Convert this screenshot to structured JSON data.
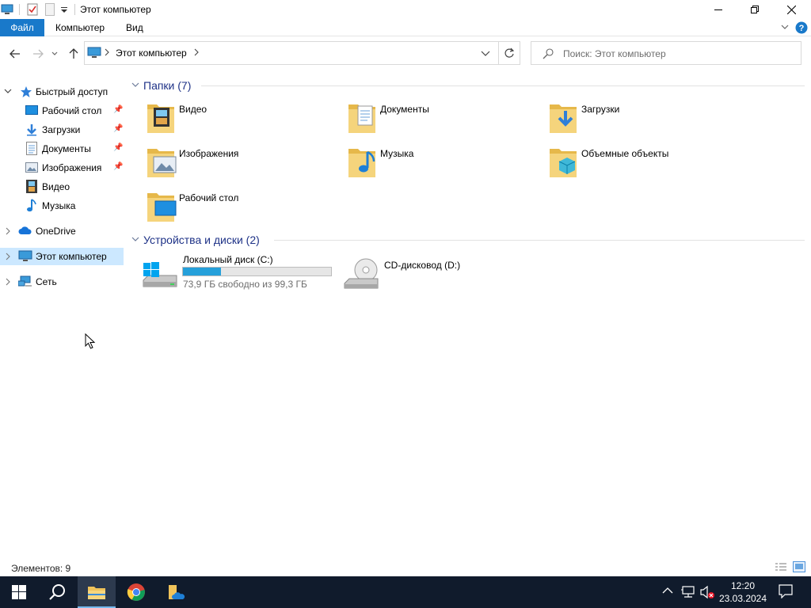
{
  "window": {
    "title": "Этот компьютер"
  },
  "ribbon": {
    "tabs": [
      "Файл",
      "Компьютер",
      "Вид"
    ]
  },
  "address": {
    "path_root": "Этот компьютер",
    "search_placeholder": "Поиск: Этот компьютер"
  },
  "nav": {
    "quick_access": "Быстрый доступ",
    "items": [
      "Рабочий стол",
      "Загрузки",
      "Документы",
      "Изображения",
      "Видео",
      "Музыка"
    ],
    "onedrive": "OneDrive",
    "this_pc": "Этот компьютер",
    "network": "Сеть"
  },
  "folders": {
    "header": "Папки (7)",
    "items": [
      {
        "label": "Видео",
        "icon": "video-folder-icon"
      },
      {
        "label": "Документы",
        "icon": "documents-folder-icon"
      },
      {
        "label": "Загрузки",
        "icon": "downloads-folder-icon"
      },
      {
        "label": "Изображения",
        "icon": "pictures-folder-icon"
      },
      {
        "label": "Музыка",
        "icon": "music-folder-icon"
      },
      {
        "label": "Объемные объекты",
        "icon": "3d-objects-folder-icon"
      },
      {
        "label": "Рабочий стол",
        "icon": "desktop-folder-icon"
      }
    ]
  },
  "devices": {
    "header": "Устройства и диски (2)",
    "local_disk": {
      "label": "Локальный диск (C:)",
      "free_text": "73,9 ГБ свободно из 99,3 ГБ",
      "used_fraction": 0.256
    },
    "cd_drive": {
      "label": "CD-дисковод (D:)"
    }
  },
  "status": {
    "count": "Элементов: 9"
  },
  "taskbar": {
    "time": "12:20",
    "date": "23.03.2024"
  },
  "colors": {
    "accent": "#1979ca",
    "selection": "#cce8ff",
    "taskbar": "#101b2c",
    "disk_bar": "#26a0da"
  }
}
